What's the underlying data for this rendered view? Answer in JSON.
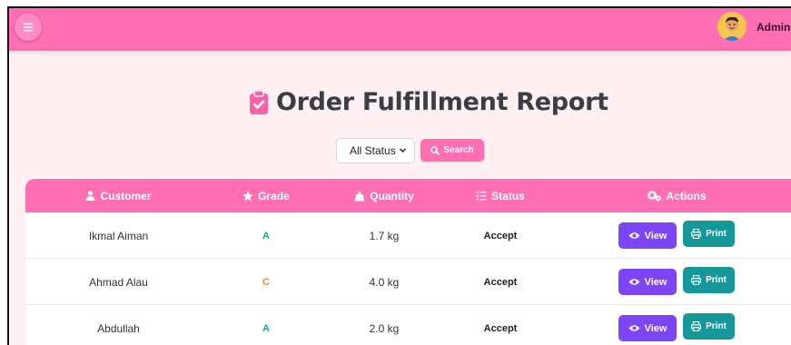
{
  "header": {
    "user_name": "Admin",
    "icons": [
      "menu-icon",
      "avatar"
    ]
  },
  "page": {
    "title": "Order Fulfillment Report",
    "title_icon": "clipboard-check-icon"
  },
  "filters": {
    "status_select_value": "All Status",
    "search_label": "Search"
  },
  "table": {
    "columns": [
      {
        "label": "Customer",
        "icon": "user-icon"
      },
      {
        "label": "Grade",
        "icon": "star-icon"
      },
      {
        "label": "Quantity",
        "icon": "weight-icon"
      },
      {
        "label": "Status",
        "icon": "list-check-icon"
      },
      {
        "label": "Actions",
        "icon": "gears-icon"
      }
    ],
    "rows": [
      {
        "customer": "Ikmal Aiman",
        "grade": "A",
        "quantity": "1.7 kg",
        "status": "Accept",
        "view_label": "View",
        "print_label": "Print"
      },
      {
        "customer": "Ahmad Alau",
        "grade": "C",
        "quantity": "4.0 kg",
        "status": "Accept",
        "view_label": "View",
        "print_label": "Print"
      },
      {
        "customer": "Abdullah",
        "grade": "A",
        "quantity": "2.0 kg",
        "status": "Accept",
        "view_label": "View",
        "print_label": "Print"
      }
    ]
  },
  "colors": {
    "brand_pink": "#ff6fb1",
    "page_background": "#fff0f4",
    "view_button": "#7c45f5",
    "print_button": "#16989a",
    "grade_a": "#16a39b",
    "grade_c": "#f08a1c"
  }
}
